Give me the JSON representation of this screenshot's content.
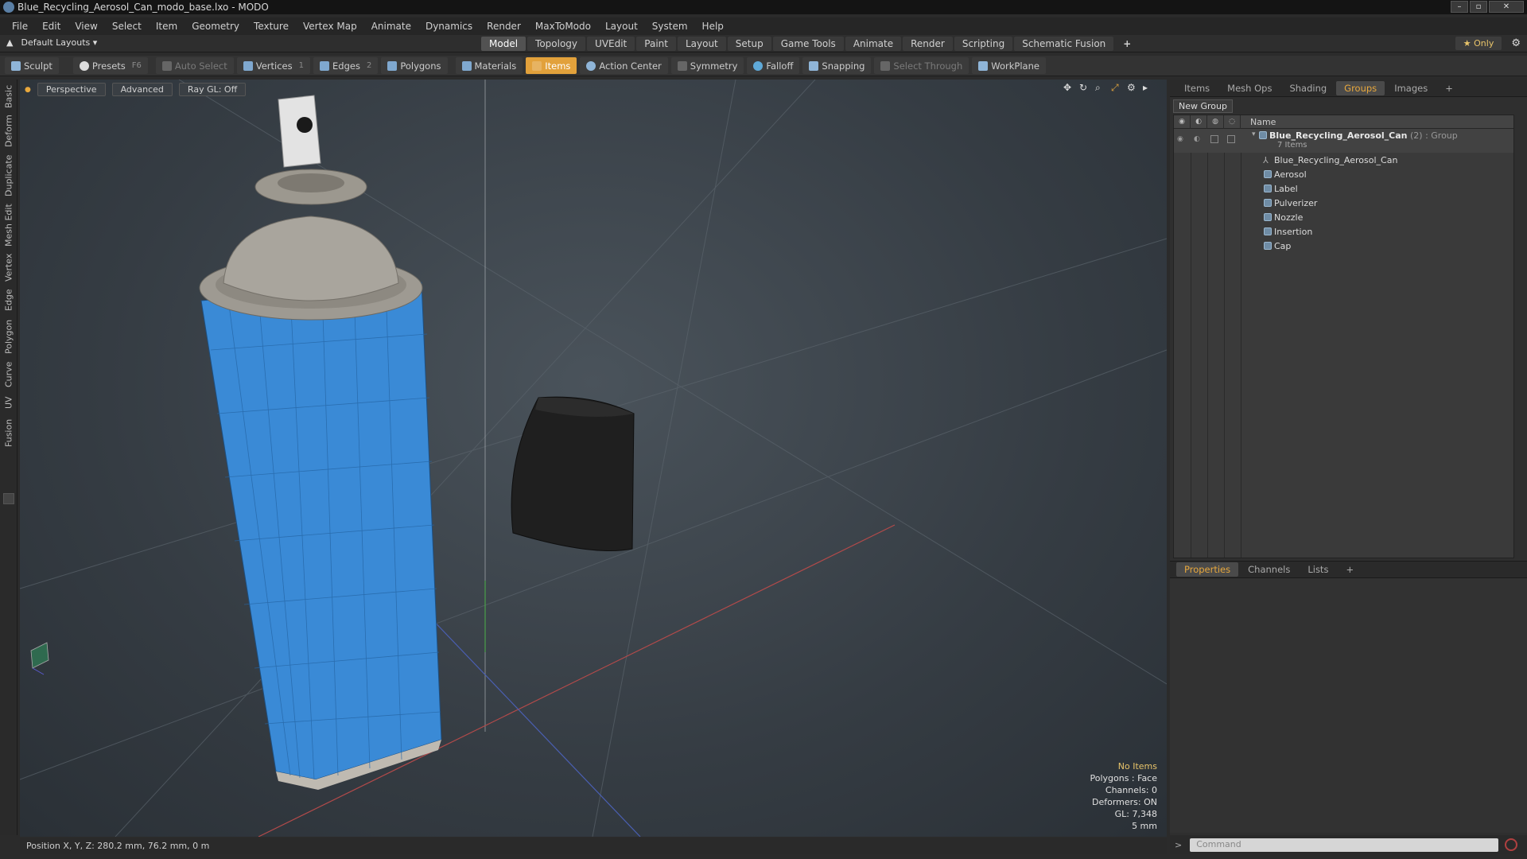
{
  "window": {
    "title": "Blue_Recycling_Aerosol_Can_modo_base.lxo - MODO",
    "controls": [
      "–",
      "▫",
      "✕"
    ]
  },
  "menu": [
    "File",
    "Edit",
    "View",
    "Select",
    "Item",
    "Geometry",
    "Texture",
    "Vertex Map",
    "Animate",
    "Dynamics",
    "Render",
    "MaxToModo",
    "Layout",
    "System",
    "Help"
  ],
  "layout": {
    "preset": "Default Layouts ▾",
    "tabs": [
      "Model",
      "Topology",
      "UVEdit",
      "Paint",
      "Layout",
      "Setup",
      "Game Tools",
      "Animate",
      "Render",
      "Scripting",
      "Schematic Fusion"
    ],
    "active_tab": "Model",
    "add": "+",
    "only": "★  Only",
    "settings_icon": "gear-icon"
  },
  "toolbar": {
    "sculpt": "Sculpt",
    "presets": "Presets",
    "presets_key": "F6",
    "auto_select": "Auto Select",
    "vertices": "Vertices",
    "vertices_count": "1",
    "edges": "Edges",
    "edges_count": "2",
    "polygons": "Polygons",
    "materials": "Materials",
    "items": "Items",
    "action_center": "Action Center",
    "symmetry": "Symmetry",
    "falloff": "Falloff",
    "snapping": "Snapping",
    "select_through": "Select Through",
    "workplane": "WorkPlane"
  },
  "left_tabs": [
    "Basic",
    "Deform",
    "Duplicate",
    "Mesh Edit",
    "Vertex",
    "Edge",
    "Polygon",
    "Curve",
    "UV",
    "Fusion"
  ],
  "viewport": {
    "view": "Perspective",
    "mode": "Advanced",
    "raygl": "Ray GL: Off",
    "stats": {
      "items": "No Items",
      "polygons": "Polygons : Face",
      "channels": "Channels: 0",
      "deformers": "Deformers: ON",
      "gl": "GL: 7,348",
      "grid": "5 mm"
    },
    "colors": {
      "can": "#3a8ad6",
      "cap": "#222222",
      "top": "#9e9a92"
    }
  },
  "status": {
    "position": "Position X, Y, Z:  280.2 mm, 76.2 mm, 0 m"
  },
  "panel": {
    "tabs": [
      "Items",
      "Mesh Ops",
      "Shading",
      "Groups",
      "Images",
      "+"
    ],
    "active_tab": "Groups",
    "new_group": "New Group",
    "name_header": "Name",
    "group": {
      "name": "Blue_Recycling_Aerosol_Can",
      "count": " (2) : Group",
      "sub": "7 Items"
    },
    "items": [
      "Blue_Recycling_Aerosol_Can",
      "Aerosol",
      "Label",
      "Pulverizer",
      "Nozzle",
      "Insertion",
      "Cap"
    ],
    "props_tabs": [
      "Properties",
      "Channels",
      "Lists",
      "+"
    ],
    "command_placeholder": "Command"
  }
}
